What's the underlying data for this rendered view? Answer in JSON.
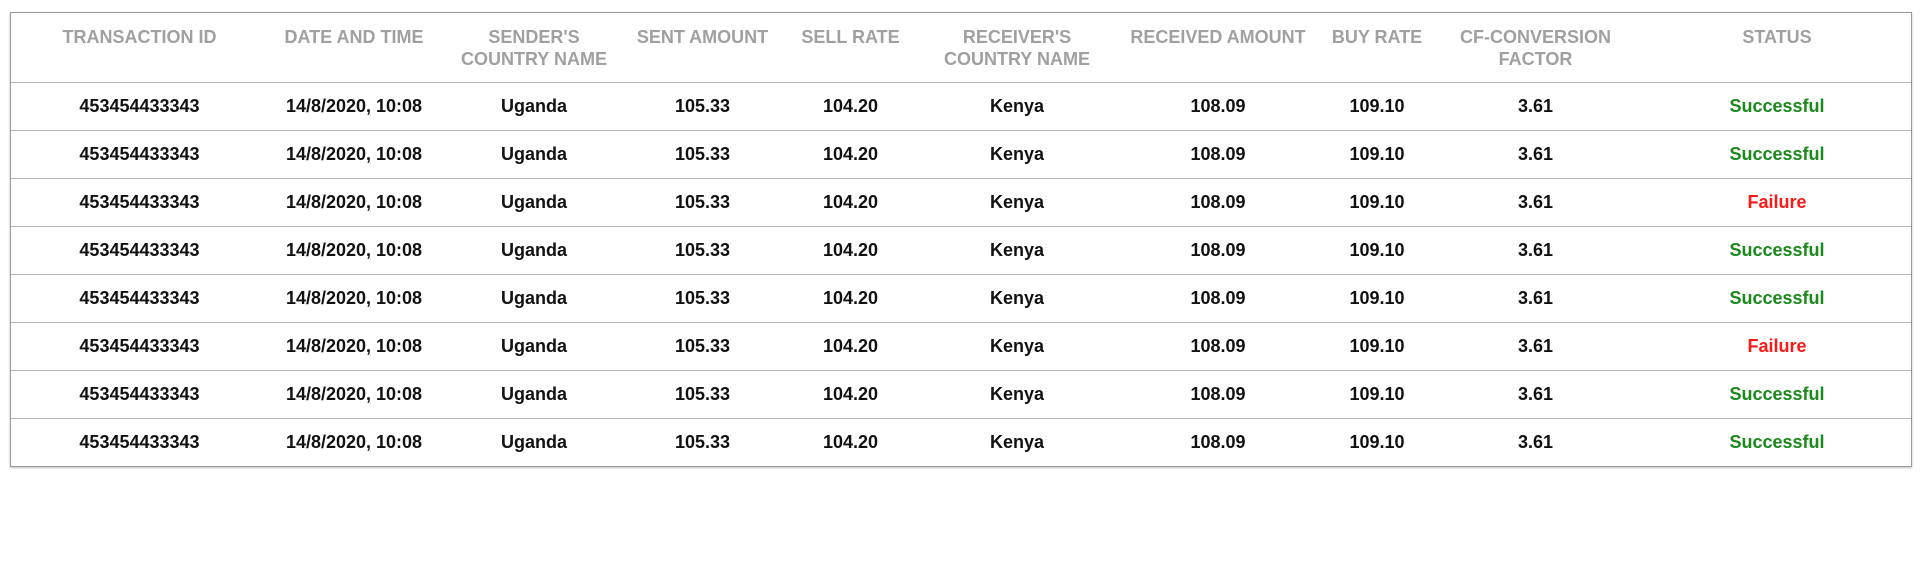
{
  "table": {
    "headers": [
      "TRANSACTION ID",
      "DATE AND TIME",
      "SENDER'S COUNTRY NAME",
      "SENT AMOUNT",
      "SELL RATE",
      "RECEIVER'S COUNTRY NAME",
      "RECEIVED AMOUNT",
      "BUY RATE",
      "CF-CONVERSION FACTOR",
      "STATUS"
    ],
    "rows": [
      [
        "453454433343",
        "14/8/2020, 10:08",
        "Uganda",
        "105.33",
        "104.20",
        "Kenya",
        "108.09",
        "109.10",
        "3.61",
        "Successful"
      ],
      [
        "453454433343",
        "14/8/2020, 10:08",
        "Uganda",
        "105.33",
        "104.20",
        "Kenya",
        "108.09",
        "109.10",
        "3.61",
        "Successful"
      ],
      [
        "453454433343",
        "14/8/2020, 10:08",
        "Uganda",
        "105.33",
        "104.20",
        "Kenya",
        "108.09",
        "109.10",
        "3.61",
        "Failure"
      ],
      [
        "453454433343",
        "14/8/2020, 10:08",
        "Uganda",
        "105.33",
        "104.20",
        "Kenya",
        "108.09",
        "109.10",
        "3.61",
        "Successful"
      ],
      [
        "453454433343",
        "14/8/2020, 10:08",
        "Uganda",
        "105.33",
        "104.20",
        "Kenya",
        "108.09",
        "109.10",
        "3.61",
        "Successful"
      ],
      [
        "453454433343",
        "14/8/2020, 10:08",
        "Uganda",
        "105.33",
        "104.20",
        "Kenya",
        "108.09",
        "109.10",
        "3.61",
        "Failure"
      ],
      [
        "453454433343",
        "14/8/2020, 10:08",
        "Uganda",
        "105.33",
        "104.20",
        "Kenya",
        "108.09",
        "109.10",
        "3.61",
        "Successful"
      ],
      [
        "453454433343",
        "14/8/2020, 10:08",
        "Uganda",
        "105.33",
        "104.20",
        "Kenya",
        "108.09",
        "109.10",
        "3.61",
        "Successful"
      ]
    ]
  },
  "colors": {
    "header_text": "#a0a0a0",
    "success": "#1a8a1a",
    "failure": "#ff1a1a"
  }
}
